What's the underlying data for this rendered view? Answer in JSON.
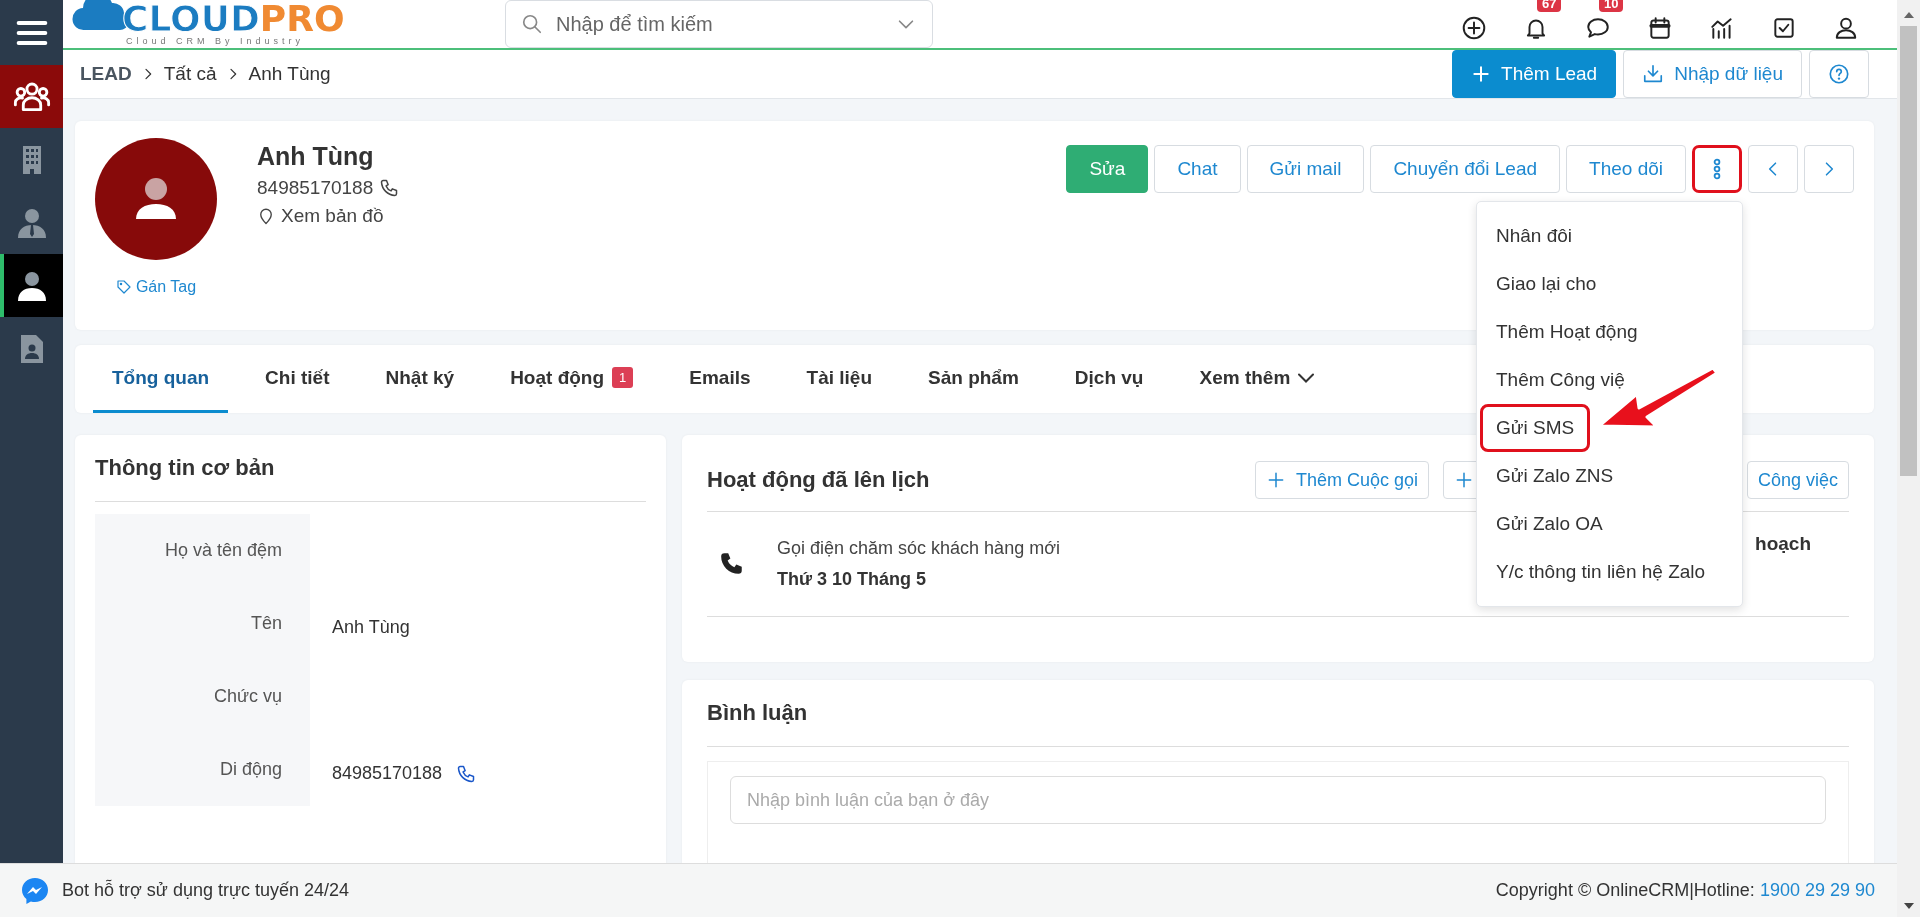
{
  "header": {
    "logo": {
      "brand_part_1": "CLOUD",
      "brand_part_2": "PRO",
      "tagline": "Cloud CRM By Industry"
    },
    "search": {
      "placeholder": "Nhập để tìm kiếm"
    },
    "icons": [
      {
        "kind": "add"
      },
      {
        "kind": "bell",
        "badge": "67"
      },
      {
        "kind": "chat",
        "badge": "10"
      },
      {
        "kind": "calendar"
      },
      {
        "kind": "chart"
      },
      {
        "kind": "task"
      },
      {
        "kind": "user"
      }
    ]
  },
  "sidebar": {
    "items": [
      {
        "kind": "leads",
        "current_module": true,
        "selected": false
      },
      {
        "kind": "building",
        "current_module": false,
        "selected": false
      },
      {
        "kind": "contact",
        "current_module": false,
        "selected": false
      },
      {
        "kind": "person",
        "current_module": false,
        "selected": true
      },
      {
        "kind": "document",
        "current_module": false,
        "selected": false
      }
    ]
  },
  "breadcrumb": [
    "LEAD",
    "Tất cả",
    "Anh Tùng"
  ],
  "page_actions": [
    {
      "kind": "primary",
      "label": "Thêm Lead"
    },
    {
      "kind": "import",
      "label": "Nhập dữ liệu"
    },
    {
      "kind": "help"
    }
  ],
  "profile": {
    "name": "Anh Tùng",
    "phone": "84985170188",
    "map_link": "Xem bản đồ",
    "tag_link": "Gán Tag",
    "buttons": [
      {
        "kind": "edit",
        "label": "Sửa",
        "highlighted": false
      },
      {
        "kind": "outline",
        "label": "Chat",
        "highlighted": false
      },
      {
        "kind": "outline",
        "label": "Gửi mail",
        "highlighted": false
      },
      {
        "kind": "outline",
        "label": "Chuyển đổi Lead",
        "highlighted": false
      },
      {
        "kind": "outline",
        "label": "Theo dõi",
        "highlighted": false
      },
      {
        "kind": "more",
        "highlighted": true
      },
      {
        "kind": "prev",
        "highlighted": false
      },
      {
        "kind": "next",
        "highlighted": false
      }
    ]
  },
  "more_menu": {
    "items": [
      {
        "label": "Nhân đôi",
        "highlighted": false
      },
      {
        "label": "Giao lại cho",
        "highlighted": false
      },
      {
        "label": "Thêm Hoạt động",
        "highlighted": false
      },
      {
        "label": "Thêm Công việ",
        "highlighted": false
      },
      {
        "label": "Gửi SMS",
        "highlighted": true
      },
      {
        "label": "Gửi Zalo ZNS",
        "highlighted": false
      },
      {
        "label": "Gửi Zalo OA",
        "highlighted": false
      },
      {
        "label": "Y/c thông tin liên hệ Zalo",
        "highlighted": false
      }
    ]
  },
  "tabs": [
    {
      "kind": "tab",
      "label": "Tổng quan",
      "selected": true
    },
    {
      "kind": "tab",
      "label": "Chi tiết",
      "selected": false
    },
    {
      "kind": "tab",
      "label": "Nhật ký",
      "selected": false
    },
    {
      "kind": "tab",
      "label": "Hoạt động",
      "badge": "1",
      "selected": false
    },
    {
      "kind": "tab",
      "label": "Emails",
      "selected": false
    },
    {
      "kind": "tab",
      "label": "Tài liệu",
      "selected": false
    },
    {
      "kind": "tab",
      "label": "Sản phẩm",
      "selected": false
    },
    {
      "kind": "tab",
      "label": "Dịch vụ",
      "selected": false
    },
    {
      "kind": "dropdown",
      "label": "Xem thêm",
      "selected": false
    }
  ],
  "basic_info": {
    "title": "Thông tin cơ bản",
    "fields": [
      {
        "kind": "text",
        "label": "Họ và tên đệm"
      },
      {
        "kind": "text",
        "label": "Tên",
        "value": "Anh Tùng"
      },
      {
        "kind": "text",
        "label": "Chức vụ"
      },
      {
        "kind": "phone",
        "label": "Di động",
        "value": "84985170188"
      }
    ]
  },
  "scheduled": {
    "title": "Hoạt động đã lên lịch",
    "buttons": [
      {
        "kind": "add",
        "label": "Thêm Cuộc gọi"
      },
      {
        "kind": "add"
      },
      {
        "kind": "plain",
        "label": "Công việc"
      }
    ],
    "activities": [
      {
        "kind": "call",
        "title": "Gọi điện chăm sóc khách hàng mới",
        "date": "Thứ 3 10 Tháng 5",
        "status": "hoạch"
      }
    ]
  },
  "comments": {
    "title": "Bình luận",
    "placeholder": "Nhập bình luận của bạn ở đây"
  },
  "footer": {
    "bot_text": "Bot hỗ trợ sử dụng trực tuyến 24/24",
    "copyright": "Copyright © OnlineCRM|Hotline:",
    "hotline": "1900 29 29 90"
  }
}
